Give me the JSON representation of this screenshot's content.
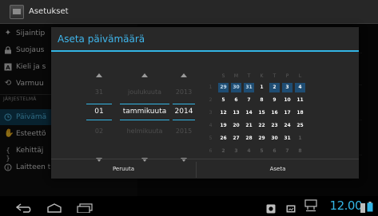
{
  "app": {
    "title": "Asetukset"
  },
  "settings": {
    "items": [
      {
        "label": "Sijaintip",
        "icon": "location-icon"
      },
      {
        "label": "Suojaus",
        "icon": "lock-icon"
      },
      {
        "label": "Kieli ja s",
        "icon": "language-icon"
      },
      {
        "label": "Varmuu",
        "icon": "backup-icon"
      }
    ],
    "section_header": "JÄRJESTELMÄ",
    "system_items": [
      {
        "label": "Päivämä",
        "icon": "clock-icon",
        "active": true
      },
      {
        "label": "Esteettö",
        "icon": "accessibility-icon"
      },
      {
        "label": "Kehittäj",
        "icon": "developer-icon"
      },
      {
        "label": "Laitteen tiedot",
        "icon": "info-icon"
      }
    ]
  },
  "dialog": {
    "title": "Aseta päivämäärä",
    "picker": {
      "day": {
        "prev": "31",
        "current": "01",
        "next": "02"
      },
      "month": {
        "prev": "joulukuuta",
        "current": "tammikuuta",
        "next": "helmikuuta"
      },
      "year": {
        "prev": "2013",
        "current": "2014",
        "next": "2015"
      }
    },
    "calendar": {
      "weekdays": [
        "S",
        "M",
        "T",
        "K",
        "T",
        "P",
        "L"
      ],
      "weeks": [
        {
          "week": "1",
          "days": [
            "29",
            "30",
            "31",
            "1",
            "2",
            "3",
            "4"
          ]
        },
        {
          "week": "2",
          "days": [
            "5",
            "6",
            "7",
            "8",
            "9",
            "10",
            "11"
          ]
        },
        {
          "week": "3",
          "days": [
            "12",
            "13",
            "14",
            "15",
            "16",
            "17",
            "18"
          ]
        },
        {
          "week": "4",
          "days": [
            "19",
            "20",
            "21",
            "22",
            "23",
            "24",
            "25"
          ]
        },
        {
          "week": "5",
          "days": [
            "26",
            "27",
            "28",
            "29",
            "30",
            "31",
            "1"
          ]
        },
        {
          "week": "6",
          "days": [
            "2",
            "3",
            "4",
            "5",
            "6",
            "7",
            "8"
          ]
        }
      ]
    },
    "cancel_label": "Peruuta",
    "set_label": "Aseta"
  },
  "status": {
    "time": "12.00"
  },
  "colors": {
    "accent": "#33b5e5",
    "selected_day": "#1f4d73"
  }
}
